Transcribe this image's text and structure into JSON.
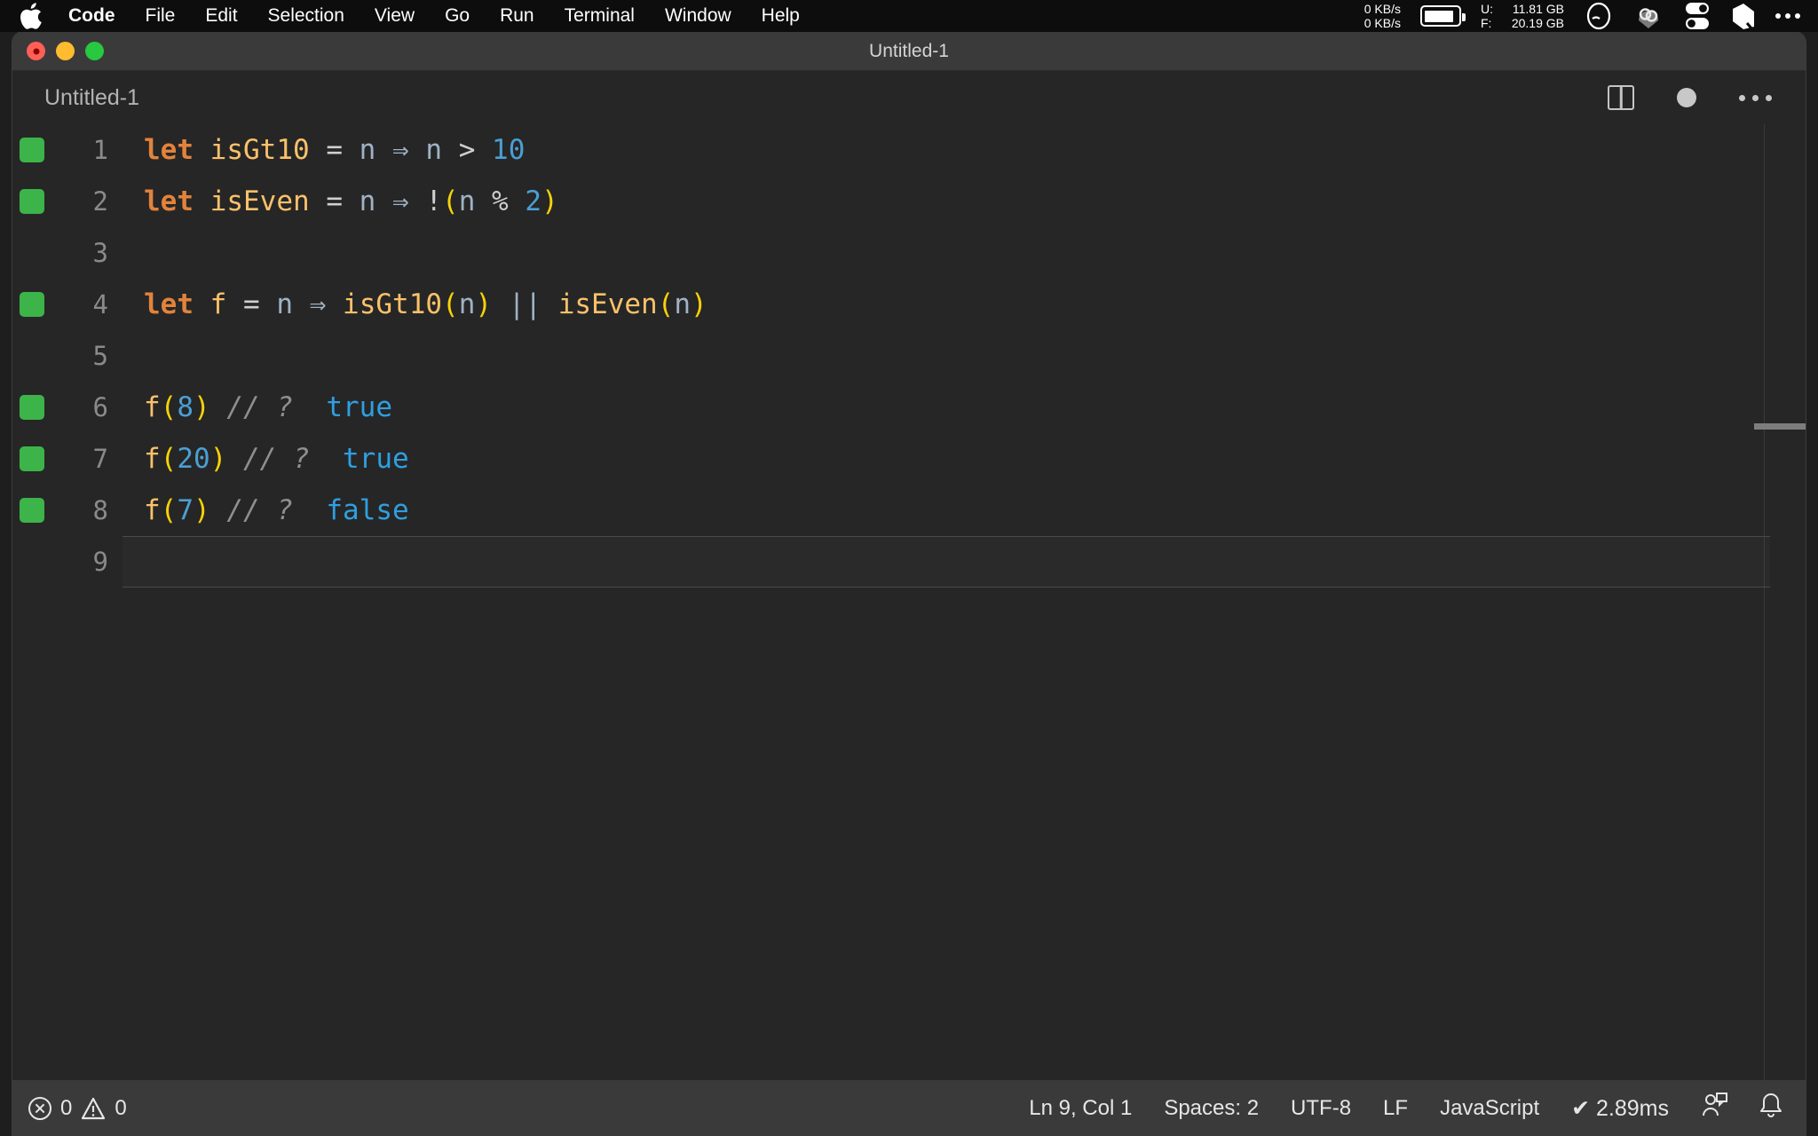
{
  "menubar": {
    "apple_icon": "apple-logo",
    "items": [
      {
        "label": "Code",
        "bold": true
      },
      {
        "label": "File",
        "bold": false
      },
      {
        "label": "Edit",
        "bold": false
      },
      {
        "label": "Selection",
        "bold": false
      },
      {
        "label": "View",
        "bold": false
      },
      {
        "label": "Go",
        "bold": false
      },
      {
        "label": "Run",
        "bold": false
      },
      {
        "label": "Terminal",
        "bold": false
      },
      {
        "label": "Window",
        "bold": false
      },
      {
        "label": "Help",
        "bold": false
      }
    ],
    "network": {
      "up": "0 KB/s",
      "down": "0 KB/s"
    },
    "battery_icon": "battery-icon",
    "memory": {
      "used_label": "U:",
      "used_value": "11.81 GB",
      "free_label": "F:",
      "free_value": "20.19 GB"
    },
    "status_icons": [
      "clock-icon",
      "cloud-link-icon",
      "toggles-icon",
      "shape-icon",
      "more-dots-icon"
    ]
  },
  "window": {
    "title": "Untitled-1",
    "traffic_lights": [
      "close-button",
      "minimize-button",
      "maximize-button"
    ]
  },
  "editor_header": {
    "breadcrumb": "Untitled-1",
    "actions": [
      "split-editor-icon",
      "unsaved-dot-icon",
      "more-actions-icon"
    ]
  },
  "editor": {
    "lines": [
      {
        "number": "1",
        "marker": true,
        "current": false,
        "tokens": [
          {
            "t": "let",
            "c": "kw"
          },
          {
            "t": " ",
            "c": "op"
          },
          {
            "t": "isGt10",
            "c": "fn"
          },
          {
            "t": " ",
            "c": "op"
          },
          {
            "t": "=",
            "c": "opw"
          },
          {
            "t": " ",
            "c": "op"
          },
          {
            "t": "n",
            "c": "op"
          },
          {
            "t": " ",
            "c": "op"
          },
          {
            "t": "⇒",
            "c": "op"
          },
          {
            "t": " ",
            "c": "op"
          },
          {
            "t": "n",
            "c": "op"
          },
          {
            "t": " ",
            "c": "op"
          },
          {
            "t": ">",
            "c": "opw"
          },
          {
            "t": " ",
            "c": "op"
          },
          {
            "t": "10",
            "c": "num"
          }
        ],
        "plain": "let isGt10 = n ⇒ n > 10"
      },
      {
        "number": "2",
        "marker": true,
        "current": false,
        "tokens": [
          {
            "t": "let",
            "c": "kw"
          },
          {
            "t": " ",
            "c": "op"
          },
          {
            "t": "isEven",
            "c": "fn"
          },
          {
            "t": " ",
            "c": "op"
          },
          {
            "t": "=",
            "c": "opw"
          },
          {
            "t": " ",
            "c": "op"
          },
          {
            "t": "n",
            "c": "op"
          },
          {
            "t": " ",
            "c": "op"
          },
          {
            "t": "⇒",
            "c": "op"
          },
          {
            "t": " ",
            "c": "op"
          },
          {
            "t": "!",
            "c": "opw"
          },
          {
            "t": "(",
            "c": "paren"
          },
          {
            "t": "n",
            "c": "op"
          },
          {
            "t": " ",
            "c": "op"
          },
          {
            "t": "%",
            "c": "opw"
          },
          {
            "t": " ",
            "c": "op"
          },
          {
            "t": "2",
            "c": "num"
          },
          {
            "t": ")",
            "c": "paren"
          }
        ],
        "plain": "let isEven = n ⇒ !(n % 2)"
      },
      {
        "number": "3",
        "marker": false,
        "current": false,
        "tokens": [],
        "plain": ""
      },
      {
        "number": "4",
        "marker": true,
        "current": false,
        "tokens": [
          {
            "t": "let",
            "c": "kw"
          },
          {
            "t": " ",
            "c": "op"
          },
          {
            "t": "f",
            "c": "fn"
          },
          {
            "t": " ",
            "c": "op"
          },
          {
            "t": "=",
            "c": "opw"
          },
          {
            "t": " ",
            "c": "op"
          },
          {
            "t": "n",
            "c": "op"
          },
          {
            "t": " ",
            "c": "op"
          },
          {
            "t": "⇒",
            "c": "op"
          },
          {
            "t": " ",
            "c": "op"
          },
          {
            "t": "isGt10",
            "c": "fn"
          },
          {
            "t": "(",
            "c": "paren"
          },
          {
            "t": "n",
            "c": "op"
          },
          {
            "t": ")",
            "c": "paren"
          },
          {
            "t": " ",
            "c": "op"
          },
          {
            "t": "||",
            "c": "pipe"
          },
          {
            "t": " ",
            "c": "op"
          },
          {
            "t": "isEven",
            "c": "fn"
          },
          {
            "t": "(",
            "c": "paren"
          },
          {
            "t": "n",
            "c": "op"
          },
          {
            "t": ")",
            "c": "paren"
          }
        ],
        "plain": "let f = n ⇒ isGt10(n) || isEven(n)"
      },
      {
        "number": "5",
        "marker": false,
        "current": false,
        "tokens": [],
        "plain": ""
      },
      {
        "number": "6",
        "marker": true,
        "current": false,
        "tokens": [
          {
            "t": "f",
            "c": "fn"
          },
          {
            "t": "(",
            "c": "paren"
          },
          {
            "t": "8",
            "c": "num"
          },
          {
            "t": ")",
            "c": "paren"
          },
          {
            "t": " ",
            "c": "op"
          },
          {
            "t": "// ?",
            "c": "cmt"
          },
          {
            "t": "  ",
            "c": "op"
          },
          {
            "t": "true",
            "c": "res"
          }
        ],
        "plain": "f(8) // ?  true"
      },
      {
        "number": "7",
        "marker": true,
        "current": false,
        "tokens": [
          {
            "t": "f",
            "c": "fn"
          },
          {
            "t": "(",
            "c": "paren"
          },
          {
            "t": "20",
            "c": "num"
          },
          {
            "t": ")",
            "c": "paren"
          },
          {
            "t": " ",
            "c": "op"
          },
          {
            "t": "// ?",
            "c": "cmt"
          },
          {
            "t": "  ",
            "c": "op"
          },
          {
            "t": "true",
            "c": "res"
          }
        ],
        "plain": "f(20) // ?  true"
      },
      {
        "number": "8",
        "marker": true,
        "current": false,
        "tokens": [
          {
            "t": "f",
            "c": "fn"
          },
          {
            "t": "(",
            "c": "paren"
          },
          {
            "t": "7",
            "c": "num"
          },
          {
            "t": ")",
            "c": "paren"
          },
          {
            "t": " ",
            "c": "op"
          },
          {
            "t": "// ?",
            "c": "cmt"
          },
          {
            "t": "  ",
            "c": "op"
          },
          {
            "t": "false",
            "c": "res"
          }
        ],
        "plain": "f(7) // ?  false"
      },
      {
        "number": "9",
        "marker": false,
        "current": true,
        "tokens": [],
        "plain": ""
      }
    ]
  },
  "statusbar": {
    "errors": "0",
    "warnings": "0",
    "cursor": "Ln 9, Col 1",
    "indentation": "Spaces: 2",
    "encoding": "UTF-8",
    "eol": "LF",
    "language": "JavaScript",
    "quokka": "✔ 2.89ms",
    "icons": [
      "feedback-icon",
      "bell-icon"
    ]
  },
  "colors": {
    "editor_bg": "#262626",
    "chrome_bg": "#3a3a3a",
    "keyword": "#e2833c",
    "function": "#fbc16a",
    "number": "#4a9fd4",
    "paren": "#f7d208",
    "comment": "#8f8f8f",
    "result": "#2f9fe0",
    "marker_green": "#3cb44a"
  }
}
